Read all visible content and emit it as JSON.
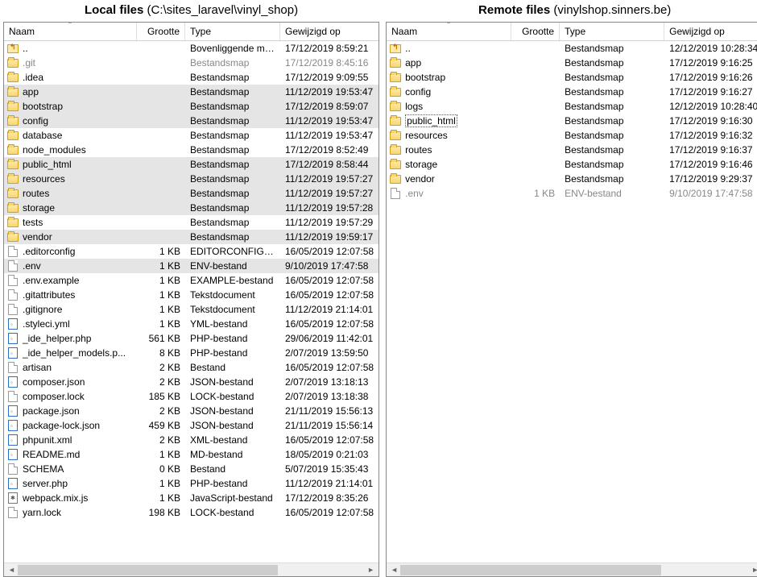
{
  "local": {
    "title_prefix": "Local files",
    "title_path": "(C:\\sites_laravel\\vinyl_shop)",
    "columns": {
      "name": "Naam",
      "size": "Grootte",
      "type": "Type",
      "modified": "Gewijzigd op"
    },
    "rows": [
      {
        "icon": "up",
        "name": "..",
        "size": "",
        "type": "Bovenliggende map",
        "mod": "17/12/2019  8:59:21",
        "sel": false
      },
      {
        "icon": "folder",
        "name": ".git",
        "size": "",
        "type": "Bestandsmap",
        "mod": "17/12/2019  8:45:16",
        "sel": false,
        "dim": true
      },
      {
        "icon": "folder",
        "name": ".idea",
        "size": "",
        "type": "Bestandsmap",
        "mod": "17/12/2019  9:09:55",
        "sel": false
      },
      {
        "icon": "folder",
        "name": "app",
        "size": "",
        "type": "Bestandsmap",
        "mod": "11/12/2019  19:53:47",
        "sel": true
      },
      {
        "icon": "folder",
        "name": "bootstrap",
        "size": "",
        "type": "Bestandsmap",
        "mod": "17/12/2019  8:59:07",
        "sel": true
      },
      {
        "icon": "folder",
        "name": "config",
        "size": "",
        "type": "Bestandsmap",
        "mod": "11/12/2019  19:53:47",
        "sel": true
      },
      {
        "icon": "folder",
        "name": "database",
        "size": "",
        "type": "Bestandsmap",
        "mod": "11/12/2019  19:53:47",
        "sel": false
      },
      {
        "icon": "folder",
        "name": "node_modules",
        "size": "",
        "type": "Bestandsmap",
        "mod": "17/12/2019  8:52:49",
        "sel": false
      },
      {
        "icon": "folder",
        "name": "public_html",
        "size": "",
        "type": "Bestandsmap",
        "mod": "17/12/2019  8:58:44",
        "sel": true
      },
      {
        "icon": "folder",
        "name": "resources",
        "size": "",
        "type": "Bestandsmap",
        "mod": "11/12/2019  19:57:27",
        "sel": true
      },
      {
        "icon": "folder",
        "name": "routes",
        "size": "",
        "type": "Bestandsmap",
        "mod": "11/12/2019  19:57:27",
        "sel": true
      },
      {
        "icon": "folder",
        "name": "storage",
        "size": "",
        "type": "Bestandsmap",
        "mod": "11/12/2019  19:57:28",
        "sel": true
      },
      {
        "icon": "folder",
        "name": "tests",
        "size": "",
        "type": "Bestandsmap",
        "mod": "11/12/2019  19:57:29",
        "sel": false
      },
      {
        "icon": "folder",
        "name": "vendor",
        "size": "",
        "type": "Bestandsmap",
        "mod": "11/12/2019  19:59:17",
        "sel": true
      },
      {
        "icon": "file",
        "name": ".editorconfig",
        "size": "1 KB",
        "type": "EDITORCONFIG-b...",
        "mod": "16/05/2019  12:07:58",
        "sel": false
      },
      {
        "icon": "file",
        "name": ".env",
        "size": "1 KB",
        "type": "ENV-bestand",
        "mod": "9/10/2019  17:47:58",
        "sel": true
      },
      {
        "icon": "file",
        "name": ".env.example",
        "size": "1 KB",
        "type": "EXAMPLE-bestand",
        "mod": "16/05/2019  12:07:58",
        "sel": false
      },
      {
        "icon": "file",
        "name": ".gitattributes",
        "size": "1 KB",
        "type": "Tekstdocument",
        "mod": "16/05/2019  12:07:58",
        "sel": false
      },
      {
        "icon": "file",
        "name": ".gitignore",
        "size": "1 KB",
        "type": "Tekstdocument",
        "mod": "11/12/2019  21:14:01",
        "sel": false
      },
      {
        "icon": "code",
        "name": ".styleci.yml",
        "size": "1 KB",
        "type": "YML-bestand",
        "mod": "16/05/2019  12:07:58",
        "sel": false
      },
      {
        "icon": "code",
        "name": "_ide_helper.php",
        "size": "561 KB",
        "type": "PHP-bestand",
        "mod": "29/06/2019  11:42:01",
        "sel": false
      },
      {
        "icon": "code",
        "name": "_ide_helper_models.p...",
        "size": "8 KB",
        "type": "PHP-bestand",
        "mod": "2/07/2019  13:59:50",
        "sel": false
      },
      {
        "icon": "file",
        "name": "artisan",
        "size": "2 KB",
        "type": "Bestand",
        "mod": "16/05/2019  12:07:58",
        "sel": false
      },
      {
        "icon": "code",
        "name": "composer.json",
        "size": "2 KB",
        "type": "JSON-bestand",
        "mod": "2/07/2019  13:18:13",
        "sel": false
      },
      {
        "icon": "file",
        "name": "composer.lock",
        "size": "185 KB",
        "type": "LOCK-bestand",
        "mod": "2/07/2019  13:18:38",
        "sel": false
      },
      {
        "icon": "code",
        "name": "package.json",
        "size": "2 KB",
        "type": "JSON-bestand",
        "mod": "21/11/2019  15:56:13",
        "sel": false
      },
      {
        "icon": "code",
        "name": "package-lock.json",
        "size": "459 KB",
        "type": "JSON-bestand",
        "mod": "21/11/2019  15:56:14",
        "sel": false
      },
      {
        "icon": "code",
        "name": "phpunit.xml",
        "size": "2 KB",
        "type": "XML-bestand",
        "mod": "16/05/2019  12:07:58",
        "sel": false
      },
      {
        "icon": "code",
        "name": "README.md",
        "size": "1 KB",
        "type": "MD-bestand",
        "mod": "18/05/2019  0:21:03",
        "sel": false
      },
      {
        "icon": "file",
        "name": "SCHEMA",
        "size": "0 KB",
        "type": "Bestand",
        "mod": "5/07/2019  15:35:43",
        "sel": false
      },
      {
        "icon": "code",
        "name": "server.php",
        "size": "1 KB",
        "type": "PHP-bestand",
        "mod": "11/12/2019  21:14:01",
        "sel": false
      },
      {
        "icon": "js",
        "name": "webpack.mix.js",
        "size": "1 KB",
        "type": "JavaScript-bestand",
        "mod": "17/12/2019  8:35:26",
        "sel": false
      },
      {
        "icon": "file",
        "name": "yarn.lock",
        "size": "198 KB",
        "type": "LOCK-bestand",
        "mod": "16/05/2019  12:07:58",
        "sel": false
      }
    ]
  },
  "remote": {
    "title_prefix": "Remote files",
    "title_path": "(vinylshop.sinners.be)",
    "columns": {
      "name": "Naam",
      "size": "Grootte",
      "type": "Type",
      "modified": "Gewijzigd op"
    },
    "rows": [
      {
        "icon": "up",
        "name": "..",
        "size": "",
        "type": "Bestandsmap",
        "mod": "12/12/2019 10:28:34",
        "sel": false
      },
      {
        "icon": "folder",
        "name": "app",
        "size": "",
        "type": "Bestandsmap",
        "mod": "17/12/2019 9:16:25",
        "sel": false
      },
      {
        "icon": "folder",
        "name": "bootstrap",
        "size": "",
        "type": "Bestandsmap",
        "mod": "17/12/2019 9:16:26",
        "sel": false
      },
      {
        "icon": "folder",
        "name": "config",
        "size": "",
        "type": "Bestandsmap",
        "mod": "17/12/2019 9:16:27",
        "sel": false
      },
      {
        "icon": "folder",
        "name": "logs",
        "size": "",
        "type": "Bestandsmap",
        "mod": "12/12/2019 10:28:40",
        "sel": false
      },
      {
        "icon": "folder",
        "name": "public_html",
        "size": "",
        "type": "Bestandsmap",
        "mod": "17/12/2019 9:16:30",
        "sel": false,
        "focus": true
      },
      {
        "icon": "folder",
        "name": "resources",
        "size": "",
        "type": "Bestandsmap",
        "mod": "17/12/2019 9:16:32",
        "sel": false
      },
      {
        "icon": "folder",
        "name": "routes",
        "size": "",
        "type": "Bestandsmap",
        "mod": "17/12/2019 9:16:37",
        "sel": false
      },
      {
        "icon": "folder",
        "name": "storage",
        "size": "",
        "type": "Bestandsmap",
        "mod": "17/12/2019 9:16:46",
        "sel": false
      },
      {
        "icon": "folder",
        "name": "vendor",
        "size": "",
        "type": "Bestandsmap",
        "mod": "17/12/2019 9:29:37",
        "sel": false
      },
      {
        "icon": "file",
        "name": ".env",
        "size": "1 KB",
        "type": "ENV-bestand",
        "mod": "9/10/2019 17:47:58",
        "sel": false,
        "dim": true
      }
    ]
  }
}
